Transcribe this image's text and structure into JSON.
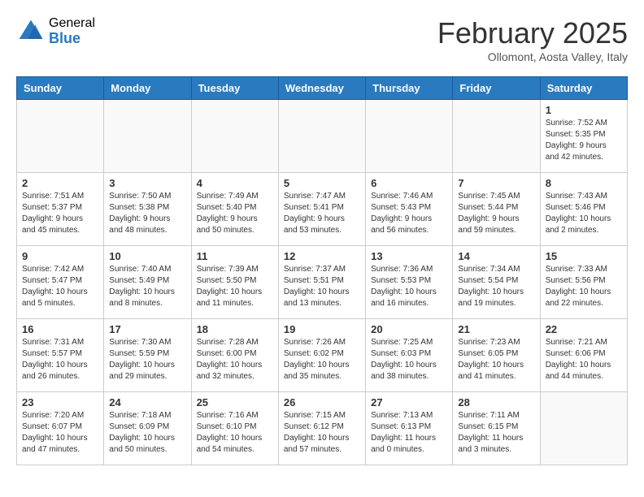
{
  "header": {
    "logo_general": "General",
    "logo_blue": "Blue",
    "month_title": "February 2025",
    "location": "Ollomont, Aosta Valley, Italy"
  },
  "weekdays": [
    "Sunday",
    "Monday",
    "Tuesday",
    "Wednesday",
    "Thursday",
    "Friday",
    "Saturday"
  ],
  "weeks": [
    [
      {
        "day": "",
        "info": ""
      },
      {
        "day": "",
        "info": ""
      },
      {
        "day": "",
        "info": ""
      },
      {
        "day": "",
        "info": ""
      },
      {
        "day": "",
        "info": ""
      },
      {
        "day": "",
        "info": ""
      },
      {
        "day": "1",
        "info": "Sunrise: 7:52 AM\nSunset: 5:35 PM\nDaylight: 9 hours and 42 minutes."
      }
    ],
    [
      {
        "day": "2",
        "info": "Sunrise: 7:51 AM\nSunset: 5:37 PM\nDaylight: 9 hours and 45 minutes."
      },
      {
        "day": "3",
        "info": "Sunrise: 7:50 AM\nSunset: 5:38 PM\nDaylight: 9 hours and 48 minutes."
      },
      {
        "day": "4",
        "info": "Sunrise: 7:49 AM\nSunset: 5:40 PM\nDaylight: 9 hours and 50 minutes."
      },
      {
        "day": "5",
        "info": "Sunrise: 7:47 AM\nSunset: 5:41 PM\nDaylight: 9 hours and 53 minutes."
      },
      {
        "day": "6",
        "info": "Sunrise: 7:46 AM\nSunset: 5:43 PM\nDaylight: 9 hours and 56 minutes."
      },
      {
        "day": "7",
        "info": "Sunrise: 7:45 AM\nSunset: 5:44 PM\nDaylight: 9 hours and 59 minutes."
      },
      {
        "day": "8",
        "info": "Sunrise: 7:43 AM\nSunset: 5:46 PM\nDaylight: 10 hours and 2 minutes."
      }
    ],
    [
      {
        "day": "9",
        "info": "Sunrise: 7:42 AM\nSunset: 5:47 PM\nDaylight: 10 hours and 5 minutes."
      },
      {
        "day": "10",
        "info": "Sunrise: 7:40 AM\nSunset: 5:49 PM\nDaylight: 10 hours and 8 minutes."
      },
      {
        "day": "11",
        "info": "Sunrise: 7:39 AM\nSunset: 5:50 PM\nDaylight: 10 hours and 11 minutes."
      },
      {
        "day": "12",
        "info": "Sunrise: 7:37 AM\nSunset: 5:51 PM\nDaylight: 10 hours and 13 minutes."
      },
      {
        "day": "13",
        "info": "Sunrise: 7:36 AM\nSunset: 5:53 PM\nDaylight: 10 hours and 16 minutes."
      },
      {
        "day": "14",
        "info": "Sunrise: 7:34 AM\nSunset: 5:54 PM\nDaylight: 10 hours and 19 minutes."
      },
      {
        "day": "15",
        "info": "Sunrise: 7:33 AM\nSunset: 5:56 PM\nDaylight: 10 hours and 22 minutes."
      }
    ],
    [
      {
        "day": "16",
        "info": "Sunrise: 7:31 AM\nSunset: 5:57 PM\nDaylight: 10 hours and 26 minutes."
      },
      {
        "day": "17",
        "info": "Sunrise: 7:30 AM\nSunset: 5:59 PM\nDaylight: 10 hours and 29 minutes."
      },
      {
        "day": "18",
        "info": "Sunrise: 7:28 AM\nSunset: 6:00 PM\nDaylight: 10 hours and 32 minutes."
      },
      {
        "day": "19",
        "info": "Sunrise: 7:26 AM\nSunset: 6:02 PM\nDaylight: 10 hours and 35 minutes."
      },
      {
        "day": "20",
        "info": "Sunrise: 7:25 AM\nSunset: 6:03 PM\nDaylight: 10 hours and 38 minutes."
      },
      {
        "day": "21",
        "info": "Sunrise: 7:23 AM\nSunset: 6:05 PM\nDaylight: 10 hours and 41 minutes."
      },
      {
        "day": "22",
        "info": "Sunrise: 7:21 AM\nSunset: 6:06 PM\nDaylight: 10 hours and 44 minutes."
      }
    ],
    [
      {
        "day": "23",
        "info": "Sunrise: 7:20 AM\nSunset: 6:07 PM\nDaylight: 10 hours and 47 minutes."
      },
      {
        "day": "24",
        "info": "Sunrise: 7:18 AM\nSunset: 6:09 PM\nDaylight: 10 hours and 50 minutes."
      },
      {
        "day": "25",
        "info": "Sunrise: 7:16 AM\nSunset: 6:10 PM\nDaylight: 10 hours and 54 minutes."
      },
      {
        "day": "26",
        "info": "Sunrise: 7:15 AM\nSunset: 6:12 PM\nDaylight: 10 hours and 57 minutes."
      },
      {
        "day": "27",
        "info": "Sunrise: 7:13 AM\nSunset: 6:13 PM\nDaylight: 11 hours and 0 minutes."
      },
      {
        "day": "28",
        "info": "Sunrise: 7:11 AM\nSunset: 6:15 PM\nDaylight: 11 hours and 3 minutes."
      },
      {
        "day": "",
        "info": ""
      }
    ]
  ]
}
